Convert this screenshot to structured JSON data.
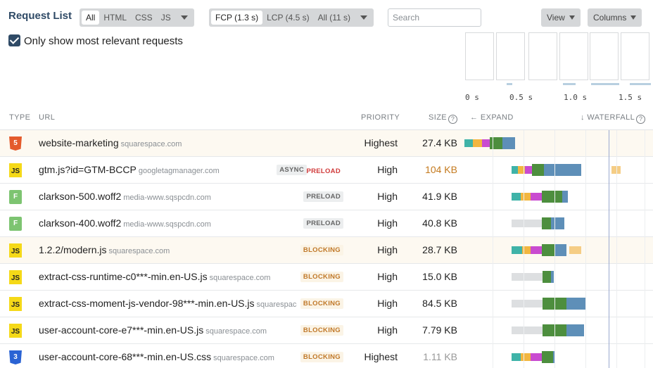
{
  "header": {
    "title": "Request List",
    "type_filters": [
      "All",
      "HTML",
      "CSS",
      "JS"
    ],
    "active_type_filter": "All",
    "time_filters": [
      "FCP (1.3 s)",
      "LCP (4.5 s)",
      "All (11 s)"
    ],
    "active_time_filter": "FCP (1.3 s)",
    "search_placeholder": "Search",
    "view_label": "View",
    "columns_label": "Columns"
  },
  "options": {
    "relevant_label": "Only show most relevant requests",
    "relevant_checked": true
  },
  "timeline": {
    "ticks": [
      "0 s",
      "0.5 s",
      "1.0 s",
      "1.5 s"
    ]
  },
  "columns": {
    "type": "TYPE",
    "url": "URL",
    "priority": "PRIORITY",
    "size": "SIZE",
    "expand": "EXPAND",
    "waterfall": "WATERFALL"
  },
  "colors": {
    "dns": "#3fb3a8",
    "connect": "#f2b640",
    "ssl": "#c94bd0",
    "wait": "#4d8e3e",
    "download": "#5e8fb8",
    "queued": "#dddfe1",
    "later": "#f5cd85",
    "size_warning": "#c47a1e"
  },
  "requests": [
    {
      "icon": "html-icon",
      "type_label": "5",
      "type_class": "ft-html",
      "url": "website-marketing",
      "domain": "squarespace.com",
      "badges": [],
      "priority": "Highest",
      "size": "27.4 KB",
      "size_color": "#222",
      "highlight": true,
      "bars": [
        [
          "dns",
          0.0,
          0.045
        ],
        [
          "connect",
          0.045,
          0.095
        ],
        [
          "ssl",
          0.095,
          0.135
        ],
        [
          "wait",
          0.135,
          0.2
        ],
        [
          "download",
          0.2,
          0.27
        ]
      ]
    },
    {
      "icon": "js-icon",
      "type_label": "JS",
      "type_class": "ft-js",
      "url": "gtm.js?id=GTM-BCCP",
      "domain": "googletagmanager.com",
      "badges": [
        [
          "ASYNC",
          "b-grey"
        ],
        [
          "PRELOAD",
          "b-red"
        ]
      ],
      "priority": "High",
      "size": "104 KB",
      "size_color": "#c47a1e",
      "highlight": false,
      "bars": [
        [
          "dns",
          0.25,
          0.285
        ],
        [
          "connect",
          0.285,
          0.32
        ],
        [
          "ssl",
          0.32,
          0.36
        ],
        [
          "wait",
          0.36,
          0.42
        ],
        [
          "download",
          0.42,
          0.62
        ],
        [
          "later",
          0.78,
          0.83
        ]
      ]
    },
    {
      "icon": "font-icon",
      "type_label": "F",
      "type_class": "ft-font",
      "url": "clarkson-500.woff2",
      "domain": "media-www.sqspcdn.com",
      "badges": [
        [
          "PRELOAD",
          "b-grey"
        ]
      ],
      "priority": "High",
      "size": "41.9 KB",
      "size_color": "#222",
      "highlight": false,
      "bars": [
        [
          "dns",
          0.25,
          0.3
        ],
        [
          "connect",
          0.3,
          0.35
        ],
        [
          "ssl",
          0.35,
          0.41
        ],
        [
          "wait",
          0.41,
          0.52
        ],
        [
          "download",
          0.52,
          0.55
        ]
      ]
    },
    {
      "icon": "font-icon",
      "type_label": "F",
      "type_class": "ft-font",
      "url": "clarkson-400.woff2",
      "domain": "media-www.sqspcdn.com",
      "badges": [
        [
          "PRELOAD",
          "b-grey"
        ]
      ],
      "priority": "High",
      "size": "40.8 KB",
      "size_color": "#222",
      "highlight": false,
      "bars": [
        [
          "queued",
          0.25,
          0.41
        ],
        [
          "wait",
          0.41,
          0.46
        ],
        [
          "download",
          0.46,
          0.53
        ]
      ]
    },
    {
      "icon": "js-icon",
      "type_label": "JS",
      "type_class": "ft-js",
      "url": "1.2.2/modern.js",
      "domain": "squarespace.com",
      "badges": [
        [
          "BLOCKING",
          "b-block"
        ]
      ],
      "priority": "High",
      "size": "28.7 KB",
      "size_color": "#222",
      "highlight": true,
      "bars": [
        [
          "dns",
          0.25,
          0.305
        ],
        [
          "connect",
          0.305,
          0.35
        ],
        [
          "ssl",
          0.35,
          0.41
        ],
        [
          "wait",
          0.41,
          0.48
        ],
        [
          "download",
          0.48,
          0.54
        ],
        [
          "later",
          0.555,
          0.62
        ]
      ]
    },
    {
      "icon": "js-icon",
      "type_label": "JS",
      "type_class": "ft-js",
      "url": "extract-css-runtime-c0***-min.en-US.js",
      "domain": "squarespace.com",
      "badges": [
        [
          "BLOCKING",
          "b-block"
        ]
      ],
      "priority": "High",
      "size": "15.0 KB",
      "size_color": "#222",
      "highlight": false,
      "bars": [
        [
          "queued",
          0.25,
          0.415
        ],
        [
          "wait",
          0.415,
          0.46
        ],
        [
          "download",
          0.46,
          0.475
        ]
      ]
    },
    {
      "icon": "js-icon",
      "type_label": "JS",
      "type_class": "ft-js",
      "url": "extract-css-moment-js-vendor-98***-min.en-US.js",
      "domain": "squarespace.com",
      "badges": [
        [
          "BLOCKING",
          "b-block"
        ]
      ],
      "priority": "High",
      "size": "84.5 KB",
      "size_color": "#222",
      "highlight": false,
      "bars": [
        [
          "queued",
          0.25,
          0.415
        ],
        [
          "wait",
          0.415,
          0.54
        ],
        [
          "download",
          0.54,
          0.645
        ]
      ]
    },
    {
      "icon": "js-icon",
      "type_label": "JS",
      "type_class": "ft-js",
      "url": "user-account-core-e7***-min.en-US.js",
      "domain": "squarespace.com",
      "badges": [
        [
          "BLOCKING",
          "b-block"
        ]
      ],
      "priority": "High",
      "size": "7.79 KB",
      "size_color": "#222",
      "highlight": false,
      "bars": [
        [
          "queued",
          0.25,
          0.415
        ],
        [
          "wait",
          0.415,
          0.54
        ],
        [
          "download",
          0.54,
          0.635
        ]
      ]
    },
    {
      "icon": "css-icon",
      "type_label": "3",
      "type_class": "ft-css",
      "url": "user-account-core-68***-min.en-US.css",
      "domain": "squarespace.com",
      "badges": [
        [
          "BLOCKING",
          "b-block"
        ]
      ],
      "priority": "Highest",
      "size": "1.11 KB",
      "size_color": "#999",
      "highlight": false,
      "bars": [
        [
          "dns",
          0.25,
          0.3
        ],
        [
          "connect",
          0.3,
          0.35
        ],
        [
          "ssl",
          0.35,
          0.41
        ],
        [
          "wait",
          0.41,
          0.47
        ],
        [
          "download",
          0.47,
          0.48
        ]
      ]
    }
  ]
}
